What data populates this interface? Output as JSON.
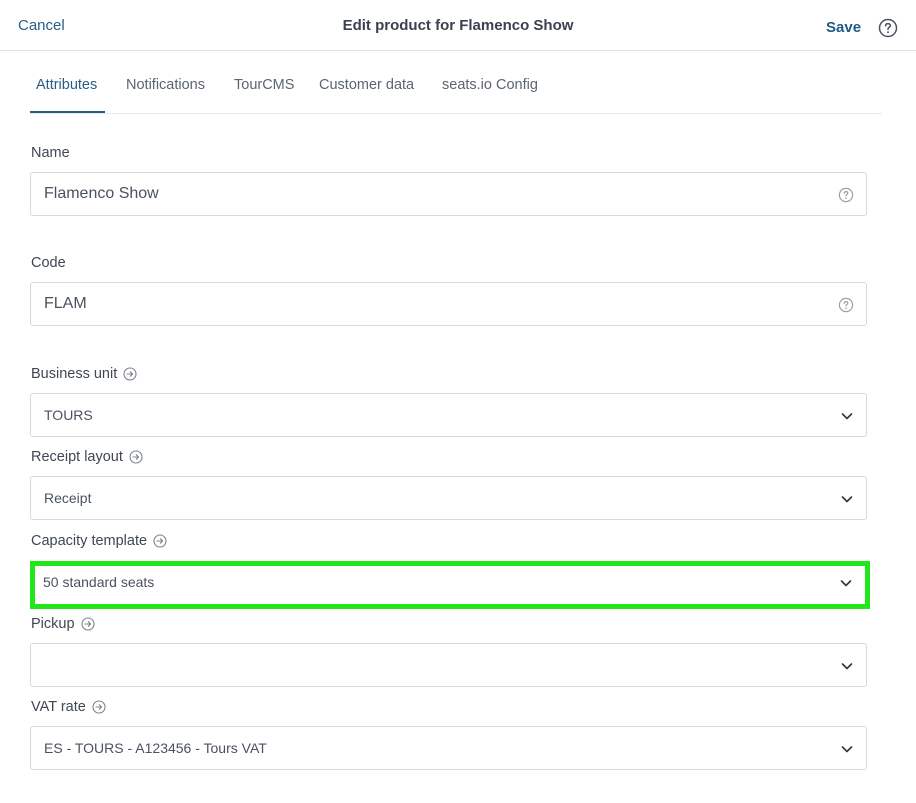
{
  "header": {
    "cancel_label": "Cancel",
    "title": "Edit product for Flamenco Show",
    "save_label": "Save",
    "help_icon": "help-circle-icon"
  },
  "tabs": [
    {
      "label": "Attributes",
      "active": true
    },
    {
      "label": "Notifications",
      "active": false
    },
    {
      "label": "TourCMS",
      "active": false
    },
    {
      "label": "Customer data",
      "active": false
    },
    {
      "label": "seats.io Config",
      "active": false
    }
  ],
  "form": {
    "name": {
      "label": "Name",
      "value": "Flamenco Show"
    },
    "code": {
      "label": "Code",
      "value": "FLAM"
    },
    "business_unit": {
      "label": "Business unit",
      "value": "TOURS"
    },
    "receipt_layout": {
      "label": "Receipt layout",
      "value": "Receipt"
    },
    "capacity_template": {
      "label": "Capacity template",
      "value": "50 standard seats",
      "highlighted": true
    },
    "pickup": {
      "label": "Pickup",
      "value": ""
    },
    "vat_rate": {
      "label": "VAT rate",
      "value": "ES - TOURS - A123456 - Tours VAT"
    }
  },
  "colors": {
    "accent": "#2a5d82",
    "highlight": "#22e619",
    "border": "#d6d9dd"
  }
}
